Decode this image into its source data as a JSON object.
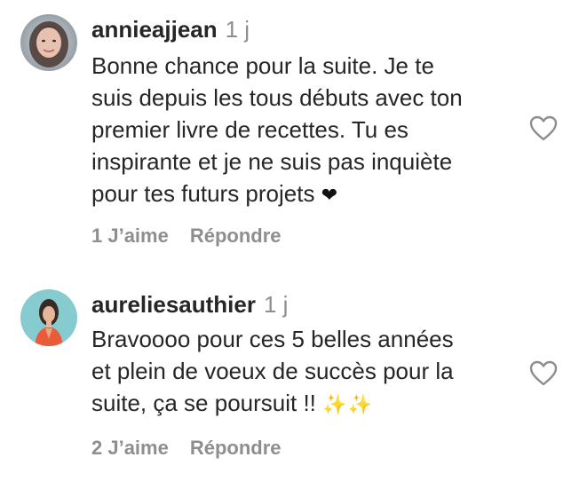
{
  "comments": [
    {
      "username": "annieajjean",
      "time": "1 j",
      "lines": [
        "Bonne chance pour la suite. Je te",
        "suis depuis les tous débuts avec ton",
        "premier livre de recettes. Tu es",
        "inspirante et je ne suis pas inquiète",
        "pour tes futurs projets"
      ],
      "emoji": "❤",
      "likes_label": "1 J’aime",
      "reply_label": "Répondre",
      "avatar_icon": "avatar-annieajjean"
    },
    {
      "username": "aureliesauthier",
      "time": "1 j",
      "lines": [
        "Bravoooo pour ces 5 belles années",
        "et plein de voeux de succès pour la",
        "suite, ça se poursuit !!"
      ],
      "emoji": "✨✨",
      "likes_label": "2 J’aime",
      "reply_label": "Répondre",
      "avatar_icon": "avatar-aureliesauthier"
    }
  ],
  "colors": {
    "text": "#262626",
    "muted": "#8e8e8e",
    "heart_outline": "#8e8e8e",
    "sparkles": "#f5c518"
  }
}
